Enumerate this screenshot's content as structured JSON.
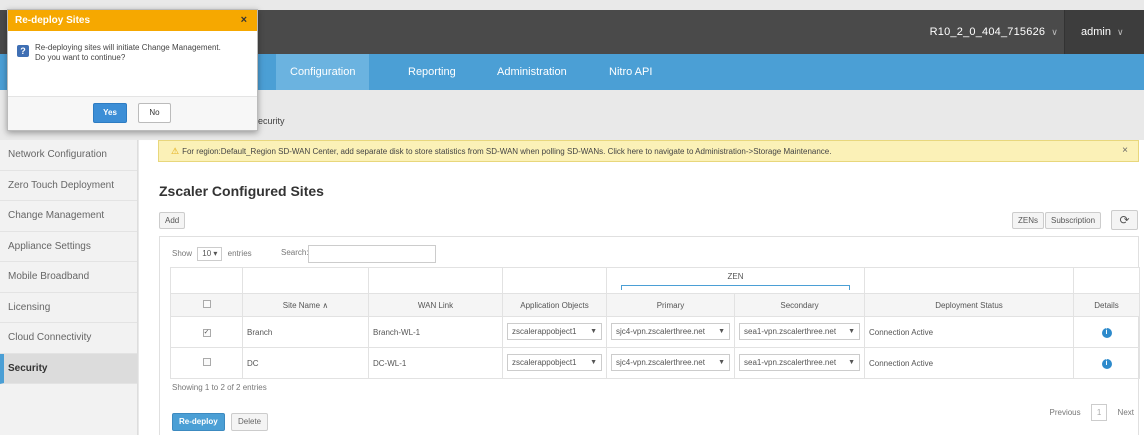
{
  "header": {
    "build": "R10_2_0_404_715626",
    "user": "admin"
  },
  "nav": {
    "tabs": [
      "Configuration",
      "Reporting",
      "Administration",
      "Nitro API"
    ],
    "active": "Configuration"
  },
  "breadcrumb": "ecurity",
  "sidebar": {
    "items": [
      {
        "label": "Network Configuration"
      },
      {
        "label": "Zero Touch Deployment"
      },
      {
        "label": "Change Management"
      },
      {
        "label": "Appliance Settings"
      },
      {
        "label": "Mobile Broadband"
      },
      {
        "label": "Licensing"
      },
      {
        "label": "Cloud Connectivity"
      },
      {
        "label": "Security"
      }
    ],
    "active": "Security"
  },
  "warning": {
    "text": "For region:Default_Region SD-WAN Center, add separate disk to store statistics from SD-WAN when polling SD-WANs. Click here to navigate to Administration->Storage Maintenance.",
    "close": "×"
  },
  "main": {
    "title": "Zscaler Configured Sites",
    "add_label": "Add",
    "zens_label": "ZENs",
    "subscription_label": "Subscription",
    "show_label": "Show",
    "entries_value": "10",
    "entries_label": "entries",
    "search_label": "Search:",
    "search_value": "",
    "showing_text": "Showing 1 to 2 of 2 entries",
    "pager": {
      "previous": "Previous",
      "page": "1",
      "next": "Next"
    },
    "redeploy_label": "Re-deploy",
    "delete_label": "Delete"
  },
  "table": {
    "group_header": "ZEN",
    "columns": [
      "Site Name",
      "WAN Link",
      "Application Objects",
      "Primary",
      "Secondary",
      "Deployment Status",
      "Details"
    ],
    "rows": [
      {
        "checked": true,
        "site": "Branch",
        "wan": "Branch-WL-1",
        "app": "zscalerappobject1",
        "primary": "sjc4-vpn.zscalerthree.net",
        "secondary": "sea1-vpn.zscalerthree.net",
        "status": "Connection Active"
      },
      {
        "checked": false,
        "site": "DC",
        "wan": "DC-WL-1",
        "app": "zscalerappobject1",
        "primary": "sjc4-vpn.zscalerthree.net",
        "secondary": "sea1-vpn.zscalerthree.net",
        "status": "Connection Active"
      }
    ]
  },
  "modal": {
    "title": "Re-deploy Sites",
    "message_line1": "Re-deploying sites will initiate Change Management.",
    "message_line2": "Do you want to continue?",
    "yes_label": "Yes",
    "no_label": "No",
    "close": "×"
  },
  "colors": {
    "nav_blue": "#4b9fd5",
    "modal_header": "#f6a800",
    "topbar": "#4a4a4a",
    "warning_bg": "#fbf1b7"
  }
}
